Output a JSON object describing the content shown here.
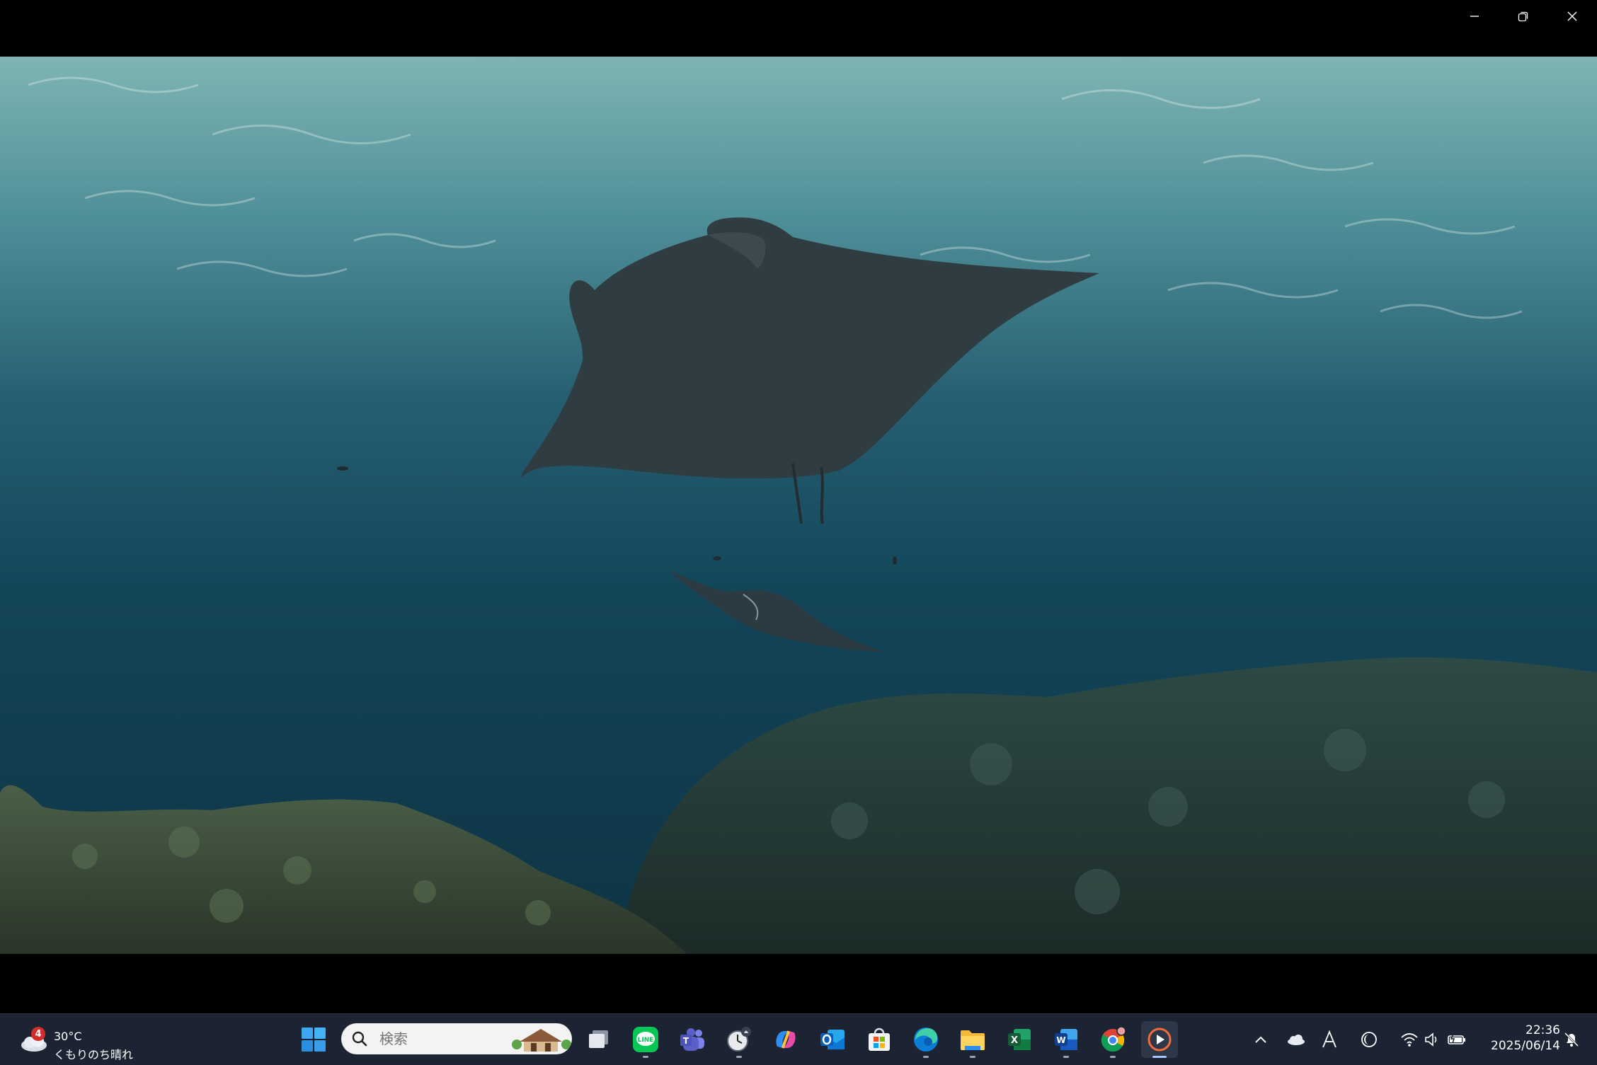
{
  "window": {
    "controls": {
      "minimize_icon": "minimize-icon",
      "restore_icon": "restore-icon",
      "close_icon": "close-icon"
    }
  },
  "video": {
    "description_icon": "manta-ray-video-frame"
  },
  "taskbar": {
    "weather": {
      "badge": "4",
      "temperature": "30°C",
      "condition": "くもりのち晴れ"
    },
    "search": {
      "placeholder": "検索"
    },
    "apps": [
      {
        "name": "task-view",
        "running": false
      },
      {
        "name": "line",
        "running": true
      },
      {
        "name": "teams",
        "running": false
      },
      {
        "name": "clock",
        "running": true
      },
      {
        "name": "copilot",
        "running": false
      },
      {
        "name": "outlook",
        "running": false
      },
      {
        "name": "microsoft-store",
        "running": false
      },
      {
        "name": "edge",
        "running": true
      },
      {
        "name": "file-explorer",
        "running": true
      },
      {
        "name": "excel",
        "running": false
      },
      {
        "name": "word",
        "running": true
      },
      {
        "name": "chrome",
        "running": true
      },
      {
        "name": "media-player",
        "running": true,
        "active": true
      }
    ],
    "tray": {
      "clock_time": "22:36",
      "clock_date": "2025/06/14"
    }
  },
  "colors": {
    "taskbar_bg": "#1c2434",
    "water_deep": "#0f3a4a",
    "water_surface": "#dfeee6"
  }
}
